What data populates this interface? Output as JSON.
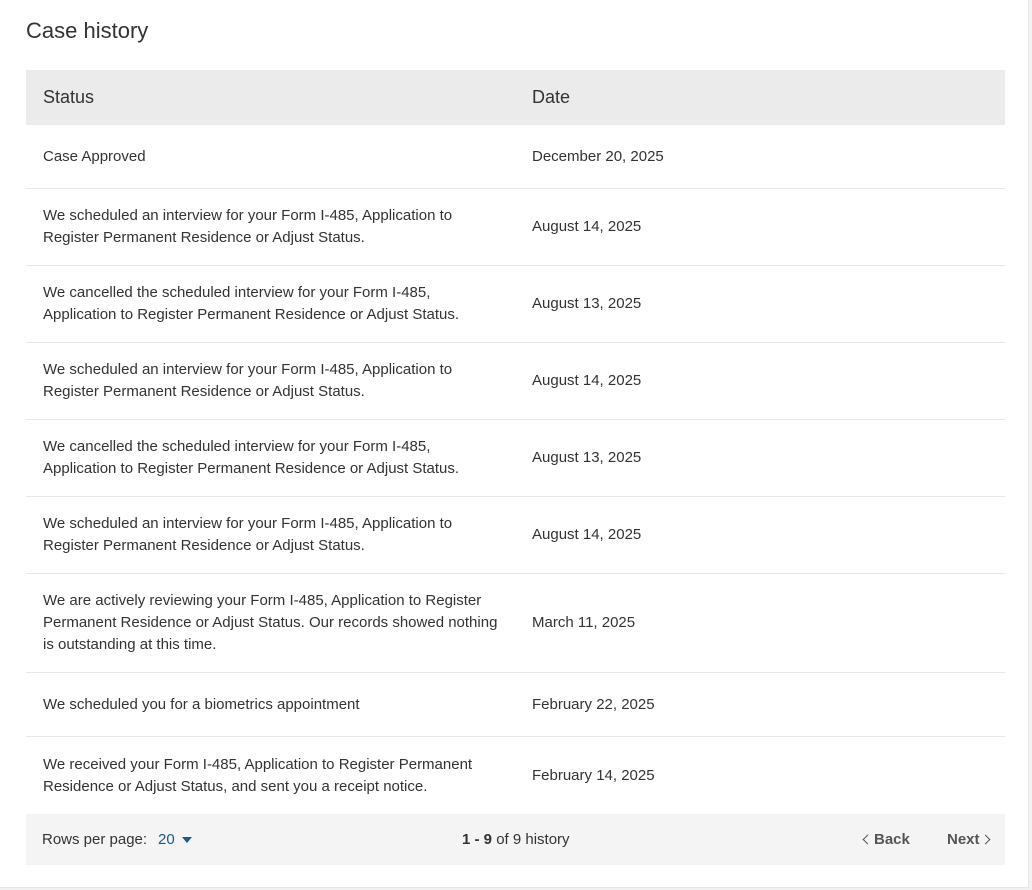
{
  "card": {
    "title": "Case history"
  },
  "table": {
    "headers": {
      "status": "Status",
      "date": "Date"
    },
    "rows": [
      {
        "status": "Case Approved",
        "date": "December 20, 2025"
      },
      {
        "status": "We scheduled an interview for your Form I-485, Application to Register Permanent Residence or Adjust Status.",
        "date": "August 14, 2025"
      },
      {
        "status": "We cancelled the scheduled interview for your Form I-485, Application to Register Permanent Residence or Adjust Status.",
        "date": "August 13, 2025"
      },
      {
        "status": "We scheduled an interview for your Form I-485, Application to Register Permanent Residence or Adjust Status.",
        "date": "August 14, 2025"
      },
      {
        "status": "We cancelled the scheduled interview for your Form I-485, Application to Register Permanent Residence or Adjust Status.",
        "date": "August 13, 2025"
      },
      {
        "status": "We scheduled an interview for your Form I-485, Application to Register Permanent Residence or Adjust Status.",
        "date": "August 14, 2025"
      },
      {
        "status": "We are actively reviewing your Form I-485, Application to Register Permanent Residence or Adjust Status. Our records showed nothing is outstanding at this time.",
        "date": "March 11, 2025"
      },
      {
        "status": "We scheduled you for a biometrics appointment",
        "date": "February 22, 2025"
      },
      {
        "status": "We received your Form I-485, Application to Register Permanent Residence or Adjust Status, and sent you a receipt notice.",
        "date": "February 14, 2025"
      }
    ]
  },
  "pagination": {
    "rows_per_page_label": "Rows per page:",
    "rows_per_page_value": "20",
    "range": "1 - 9",
    "of_text": "of 9 history",
    "back_label": "Back",
    "next_label": "Next"
  },
  "colors": {
    "header_bg": "#ebebeb",
    "footer_bg": "#f4f4f4",
    "link": "#1a5b8c",
    "text": "#333333"
  }
}
